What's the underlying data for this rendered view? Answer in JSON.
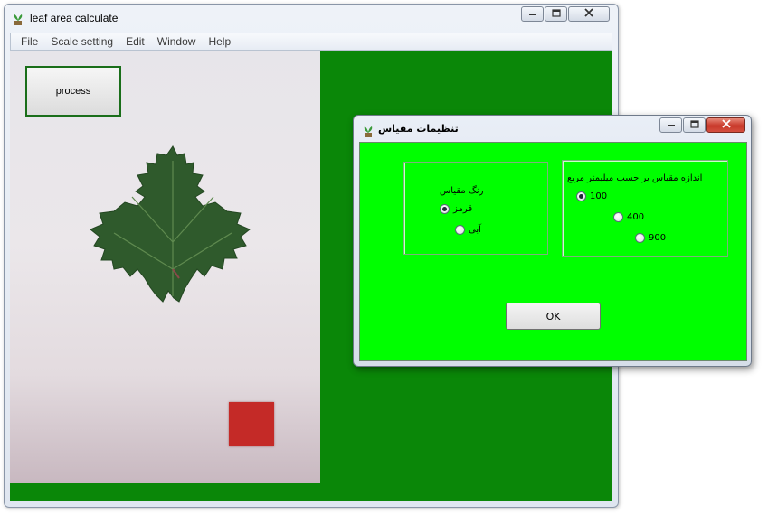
{
  "main_window": {
    "title": "leaf area calculate",
    "icon": "plant-icon",
    "caption_buttons": {
      "minimize": "minimize-icon",
      "maximize": "maximize-icon",
      "close": "close-icon"
    }
  },
  "menubar": {
    "items": [
      {
        "label": "File"
      },
      {
        "label": "Scale setting"
      },
      {
        "label": "Edit"
      },
      {
        "label": "Window"
      },
      {
        "label": "Help"
      }
    ]
  },
  "canvas": {
    "process_label": "process",
    "background_color": "#0a8708",
    "scale_square_color": "#c42a27"
  },
  "dialog": {
    "title": "تنظیمات مقیاس",
    "icon": "plant-icon",
    "background_color": "#00ff00",
    "color_group": {
      "label": "رنگ مقیاس",
      "options": [
        {
          "label": "قرمز",
          "checked": true
        },
        {
          "label": "آبی",
          "checked": false
        }
      ]
    },
    "size_group": {
      "label": "اندازه مقیاس بر حسب میلیمتر مربع",
      "options": [
        {
          "label": "100",
          "checked": true
        },
        {
          "label": "400",
          "checked": false
        },
        {
          "label": "900",
          "checked": false
        }
      ]
    },
    "ok_label": "OK"
  }
}
